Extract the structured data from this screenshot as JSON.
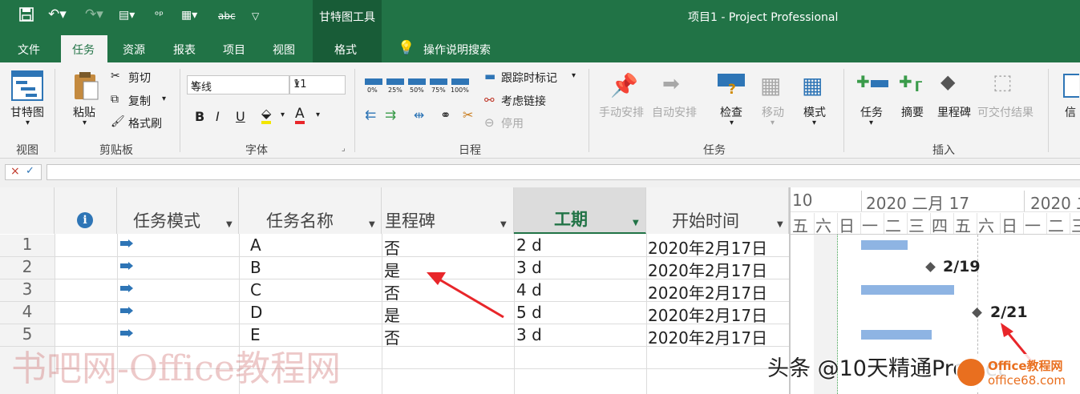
{
  "title_bar": {
    "window_title": "项目1  -  Project Professional",
    "context_tools": "甘特图工具"
  },
  "tabs": [
    {
      "label": "文件"
    },
    {
      "label": "任务",
      "active": true
    },
    {
      "label": "资源"
    },
    {
      "label": "报表"
    },
    {
      "label": "项目"
    },
    {
      "label": "视图"
    },
    {
      "label": "格式"
    }
  ],
  "tell_me": "操作说明搜索",
  "ribbon": {
    "view": {
      "gantt_label": "甘特图",
      "group": "视图"
    },
    "clipboard": {
      "paste": "粘贴",
      "cut": "剪切",
      "copy": "复制",
      "format_painter": "格式刷",
      "group": "剪贴板"
    },
    "font": {
      "font_name": "等线",
      "font_size": "11",
      "bold": "B",
      "italic": "I",
      "underline": "U",
      "group": "字体"
    },
    "schedule": {
      "pct": [
        "0%",
        "25%",
        "50%",
        "75%",
        "100%"
      ],
      "track": "跟踪时标记",
      "respect_links": "考虑链接",
      "inactivate": "停用",
      "group": "日程"
    },
    "tasks": {
      "manual": "手动安排",
      "auto": "自动安排",
      "inspect": "检查",
      "move": "移动",
      "mode": "模式",
      "group": "任务"
    },
    "insert": {
      "task": "任务",
      "summary": "摘要",
      "milestone": "里程碑",
      "deliverable": "可交付结果",
      "group": "插入",
      "info_partial": "信"
    }
  },
  "formula_bar": {
    "cancel": "×",
    "confirm": "✓",
    "value": ""
  },
  "grid": {
    "columns": {
      "info": "i",
      "mode": "任务模式",
      "name": "任务名称",
      "milestone": "里程碑",
      "duration": "工期",
      "start": "开始时间"
    },
    "rows": [
      {
        "id": "1",
        "name": "A",
        "milestone": "否",
        "duration": "2 d",
        "start": "2020年2月17日"
      },
      {
        "id": "2",
        "name": "B",
        "milestone": "是",
        "duration": "3 d",
        "start": "2020年2月17日"
      },
      {
        "id": "3",
        "name": "C",
        "milestone": "否",
        "duration": "4 d",
        "start": "2020年2月17日"
      },
      {
        "id": "4",
        "name": "D",
        "milestone": "是",
        "duration": "5 d",
        "start": "2020年2月17日"
      },
      {
        "id": "5",
        "name": "E",
        "milestone": "否",
        "duration": "3 d",
        "start": "2020年2月17日"
      }
    ]
  },
  "gantt": {
    "week_left": "10",
    "week_mid": "2020 二月 17",
    "week_right": "2020 二",
    "days": [
      "五",
      "六",
      "日",
      "一",
      "二",
      "三",
      "四",
      "五",
      "六",
      "日",
      "一",
      "二",
      "三"
    ],
    "milestone_labels": [
      "2/19",
      "2/21"
    ]
  },
  "overlay": {
    "watermark": "书吧网-Office教程网",
    "toutiao": "头条 @10天精通Project",
    "logo_line1": "Office教程网",
    "logo_line2": "office68.com"
  },
  "colors": {
    "brand_green": "#217346",
    "dark_green": "#185c37",
    "bar_blue": "#8eb4e3",
    "arrow_red": "#e8262a"
  }
}
